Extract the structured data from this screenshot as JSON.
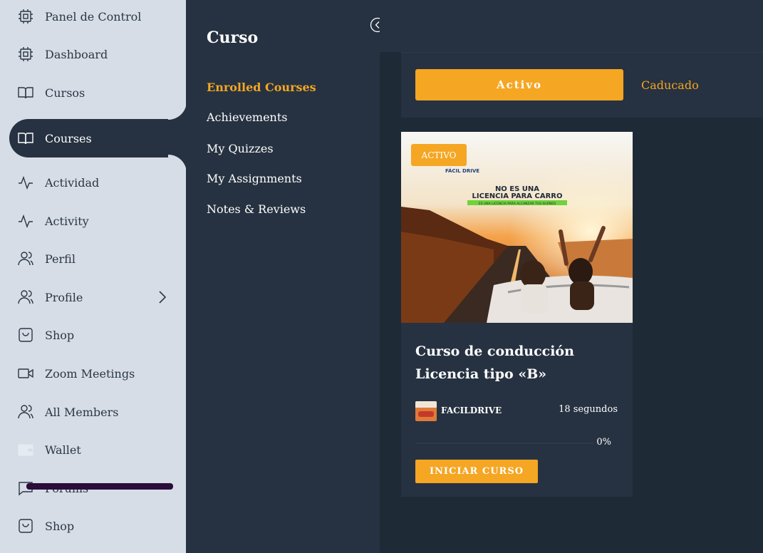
{
  "sidebar": {
    "items": [
      {
        "label": "Panel de Control",
        "icon": "chip-icon"
      },
      {
        "label": "Dashboard",
        "icon": "chip-icon"
      },
      {
        "label": "Cursos",
        "icon": "book-icon"
      },
      {
        "label": "Courses",
        "icon": "book-icon",
        "active": true
      },
      {
        "label": "Actividad",
        "icon": "activity-icon"
      },
      {
        "label": "Activity",
        "icon": "activity-icon"
      },
      {
        "label": "Perfil",
        "icon": "users-icon"
      },
      {
        "label": "Profile",
        "icon": "users-icon",
        "has_submenu": true
      },
      {
        "label": "Shop",
        "icon": "bag-icon"
      },
      {
        "label": "Zoom Meetings",
        "icon": "video-icon"
      },
      {
        "label": "All Members",
        "icon": "users-icon"
      },
      {
        "label": "Wallet",
        "icon": "wallet-icon"
      },
      {
        "label": "Forums",
        "icon": "chat-icon"
      },
      {
        "label": "Shop",
        "icon": "bag-icon"
      }
    ]
  },
  "subnav": {
    "title": "Curso",
    "items": [
      {
        "label": "Enrolled Courses",
        "active": true
      },
      {
        "label": "Achievements"
      },
      {
        "label": "My Quizzes"
      },
      {
        "label": "My Assignments"
      },
      {
        "label": "Notes & Reviews"
      }
    ]
  },
  "tabs": {
    "active": "Activo",
    "expired": "Caducado"
  },
  "course": {
    "badge": "ACTIVO",
    "image_text": {
      "brand": "FÁCIL DRIVE",
      "line1": "NO ES UNA",
      "line2": "LICENCIA PARA CARRO",
      "line3": "ES UNA LICENCIA PARA ALCANZAR TUS SUEÑOS"
    },
    "title": "Curso de conducción Licencia tipo «B»",
    "author": "FACILDRIVE",
    "duration": "18 segundos",
    "progress_percent": 0,
    "progress_label": "0%",
    "start_label": "INICIAR CURSO"
  },
  "colors": {
    "accent": "#f5a623",
    "sidebar_bg": "#d6dde6",
    "dark_bg": "#263241",
    "content_bg": "#1f2a37"
  }
}
